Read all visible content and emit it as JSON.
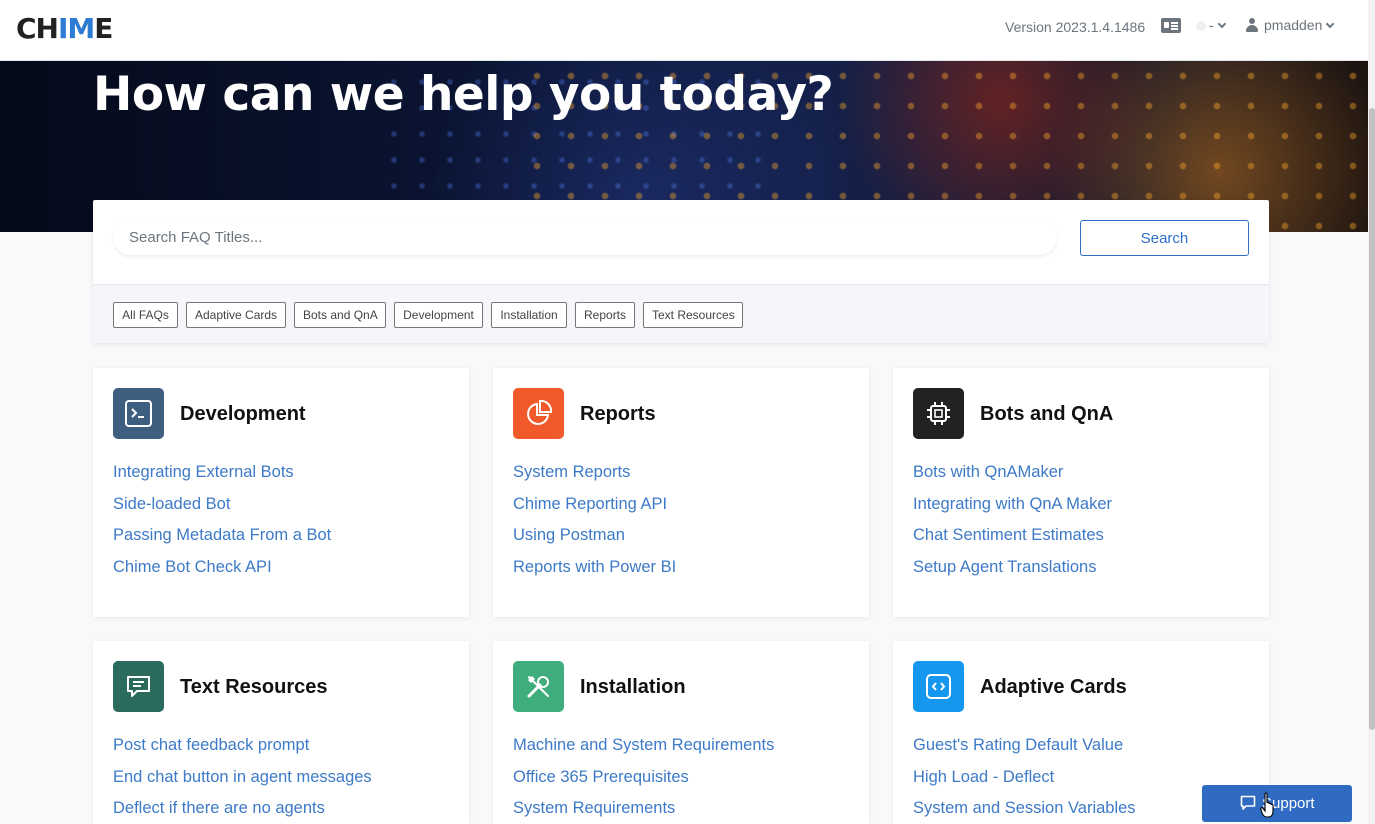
{
  "header": {
    "logo_left": "CH",
    "logo_mid": "IM",
    "logo_right": "E",
    "version": "Version 2023.1.4.1486",
    "status_label": "-",
    "username": "pmadden"
  },
  "hero": {
    "title": "How can we help you today?"
  },
  "search": {
    "placeholder": "Search FAQ Titles...",
    "button_label": "Search"
  },
  "filters": [
    "All FAQs",
    "Adaptive Cards",
    "Bots and QnA",
    "Development",
    "Installation",
    "Reports",
    "Text Resources"
  ],
  "categories": [
    {
      "title": "Development",
      "icon": "terminal-icon",
      "links": [
        "Integrating External Bots",
        "Side-loaded Bot",
        "Passing Metadata From a Bot",
        "Chime Bot Check API"
      ]
    },
    {
      "title": "Reports",
      "icon": "pie-chart-icon",
      "links": [
        "System Reports",
        "Chime Reporting API",
        "Using Postman",
        "Reports with Power BI"
      ]
    },
    {
      "title": "Bots and QnA",
      "icon": "cpu-chip-icon",
      "links": [
        "Bots with QnAMaker",
        "Integrating with QnA Maker",
        "Chat Sentiment Estimates",
        "Setup Agent Translations"
      ]
    },
    {
      "title": "Text Resources",
      "icon": "message-icon",
      "links": [
        "Post chat feedback prompt",
        "End chat button in agent messages",
        "Deflect if there are no agents"
      ]
    },
    {
      "title": "Installation",
      "icon": "tools-icon",
      "links": [
        "Machine and System Requirements",
        "Office 365 Prerequisites",
        "System Requirements"
      ]
    },
    {
      "title": "Adaptive Cards",
      "icon": "code-icon",
      "links": [
        "Guest's Rating Default Value",
        "High Load - Deflect",
        "System and Session Variables"
      ]
    }
  ],
  "support": {
    "label": "Support"
  },
  "colors": {
    "accent": "#2e6fc7",
    "link": "#3d7ac7",
    "development_icon_bg": "#3f5f80",
    "reports_icon_bg": "#f05a2a",
    "bots_icon_bg": "#222222",
    "text_resources_icon_bg": "#2a6b5d",
    "installation_icon_bg": "#3fae7c",
    "adaptive_cards_icon_bg": "#1597f0"
  }
}
